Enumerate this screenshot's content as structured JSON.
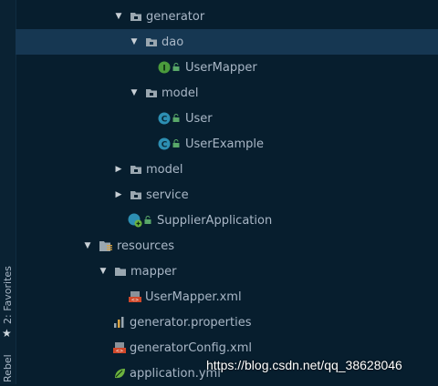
{
  "side_rail": {
    "favorites_label": "2: Favorites",
    "rebel_label": "Rebel"
  },
  "tree": {
    "items": [
      {
        "label": "generator",
        "icon": "package-icon",
        "arrow": "expanded"
      },
      {
        "label": "dao",
        "icon": "package-icon",
        "arrow": "expanded",
        "selected": true
      },
      {
        "label": "UserMapper",
        "icon": "interface-icon",
        "arrow": "none"
      },
      {
        "label": "model",
        "icon": "package-icon",
        "arrow": "expanded"
      },
      {
        "label": "User",
        "icon": "class-icon",
        "arrow": "none"
      },
      {
        "label": "UserExample",
        "icon": "class-icon",
        "arrow": "none"
      },
      {
        "label": "model",
        "icon": "package-icon",
        "arrow": "collapsed"
      },
      {
        "label": "service",
        "icon": "package-icon",
        "arrow": "collapsed"
      },
      {
        "label": "SupplierApplication",
        "icon": "spring-boot-class-icon",
        "arrow": "none"
      },
      {
        "label": "resources",
        "icon": "resources-folder-icon",
        "arrow": "expanded"
      },
      {
        "label": "mapper",
        "icon": "folder-icon",
        "arrow": "expanded"
      },
      {
        "label": "UserMapper.xml",
        "icon": "xml-file-icon",
        "arrow": "none"
      },
      {
        "label": "generator.properties",
        "icon": "properties-file-icon",
        "arrow": "none"
      },
      {
        "label": "generatorConfig.xml",
        "icon": "xml-file-icon",
        "arrow": "none"
      },
      {
        "label": "application.yml",
        "icon": "yaml-file-icon",
        "arrow": "none"
      }
    ]
  },
  "watermark": "https://blog.csdn.net/qq_38628046",
  "colors": {
    "background": "#071e2e",
    "selection": "#163752",
    "text": "#a9b7c6",
    "class_icon": "#2d8fb3",
    "interface_icon": "#4b9b3c"
  }
}
